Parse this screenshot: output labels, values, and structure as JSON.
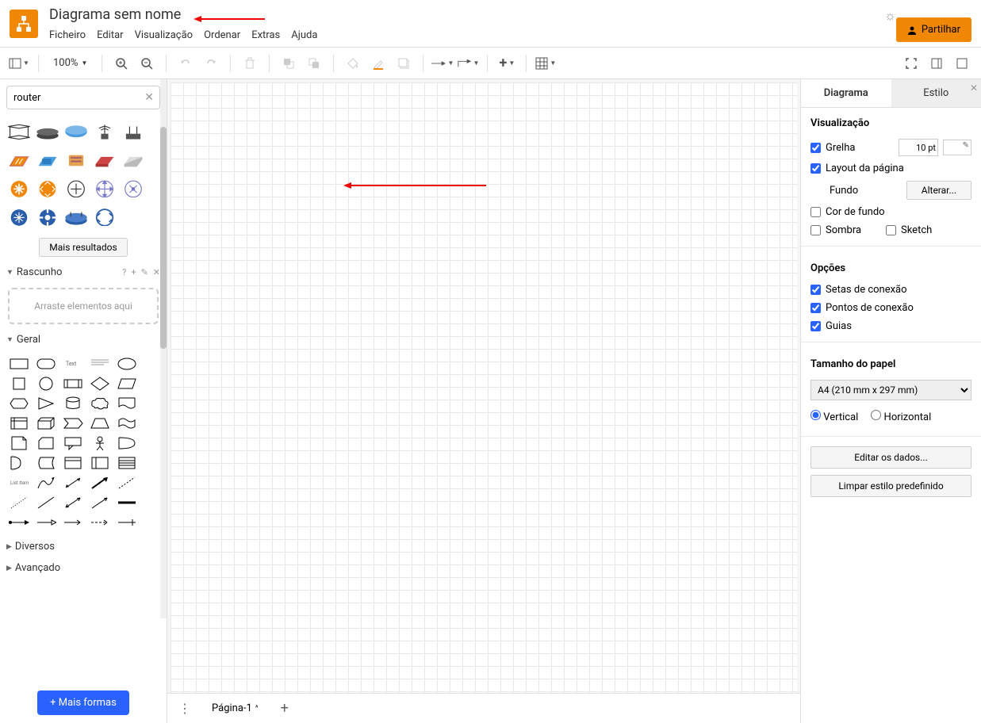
{
  "header": {
    "title": "Diagrama sem nome",
    "menu": {
      "file": "Ficheiro",
      "edit": "Editar",
      "view": "Visualização",
      "arrange": "Ordenar",
      "extras": "Extras",
      "help": "Ajuda"
    },
    "share": "Partilhar"
  },
  "toolbar": {
    "zoom": "100%"
  },
  "sidebar": {
    "search_value": "router",
    "more_results": "Mais resultados",
    "scratchpad": {
      "title": "Rascunho",
      "hint": "Arraste elementos aqui"
    },
    "general": "Geral",
    "misc": "Diversos",
    "advanced": "Avançado",
    "more_shapes": "+ Mais formas"
  },
  "pages": {
    "page1": "Página-1"
  },
  "right_panel": {
    "tabs": {
      "diagram": "Diagrama",
      "style": "Estilo"
    },
    "view_section": "Visualização",
    "grid": "Grelha",
    "grid_size": "10 pt",
    "page_layout": "Layout da página",
    "background": "Fundo",
    "change": "Alterar...",
    "bg_color": "Cor de fundo",
    "shadow": "Sombra",
    "sketch": "Sketch",
    "options_section": "Opções",
    "conn_arrows": "Setas de conexão",
    "conn_points": "Pontos de conexão",
    "guides": "Guias",
    "paper_size_section": "Tamanho do papel",
    "paper_size": "A4 (210 mm x 297 mm)",
    "portrait": "Vertical",
    "landscape": "Horizontal",
    "edit_data": "Editar os dados...",
    "clear_style": "Limpar estilo predefinido"
  }
}
